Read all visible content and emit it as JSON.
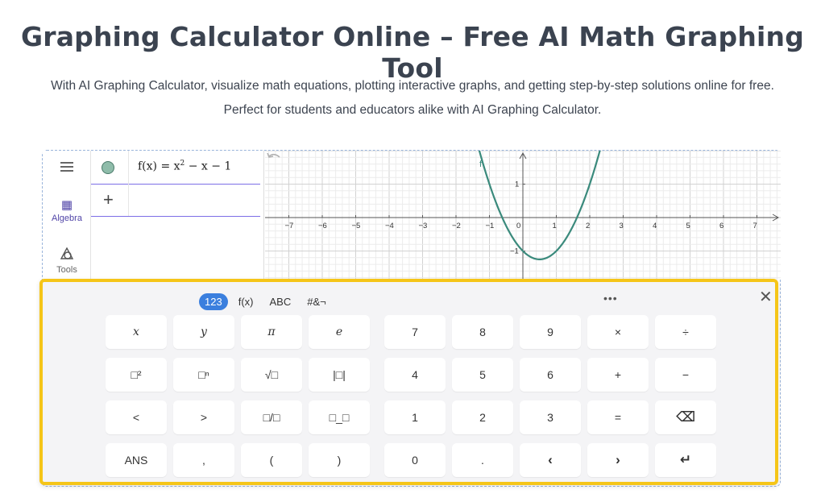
{
  "header": {
    "title": "Graphing Calculator Online – Free AI Math Graphing Tool",
    "subtitle": "With AI Graphing Calculator, visualize math equations, plotting interactive graphs, and getting step-by-step solutions online for free. Perfect for students and educators alike with AI Graphing Calculator."
  },
  "rail": {
    "menu_icon": "hamburger-icon",
    "algebra_label": "Algebra",
    "algebra_icon": "calculator-icon",
    "tools_label": "Tools",
    "tools_icon": "shapes-icon"
  },
  "algebra_view": {
    "expression_prefix": "f(x) = x",
    "expression_exp": "2",
    "expression_suffix": " − x − 1",
    "add_label": "+",
    "color": "#8fbcaa"
  },
  "graph": {
    "curve_label": "f",
    "curve_color": "#3a8a7c",
    "x_ticks": [
      "−7",
      "−6",
      "−5",
      "−4",
      "−3",
      "−2",
      "−1",
      "0",
      "1",
      "2",
      "3",
      "4",
      "5",
      "6",
      "7"
    ],
    "y_ticks": [
      "1",
      "−1"
    ]
  },
  "keyboard": {
    "tabs": [
      "123",
      "f(x)",
      "ABC",
      "#&¬"
    ],
    "active_tab": "123",
    "more_label": "•••",
    "close_label": "✕",
    "rows": [
      [
        "x",
        "y",
        "π",
        "e",
        "7",
        "8",
        "9",
        "×",
        "÷"
      ],
      [
        "□²",
        "□ⁿ",
        "√□",
        "|□|",
        "4",
        "5",
        "6",
        "+",
        "−"
      ],
      [
        "<",
        ">",
        "□/□",
        "□_□",
        "1",
        "2",
        "3",
        "=",
        "⌫"
      ],
      [
        "ANS",
        ",",
        "(",
        ")",
        "0",
        ".",
        "‹",
        "›",
        "↵"
      ]
    ]
  },
  "colors": {
    "accent": "#3b7fde",
    "highlight_border": "#f5c518",
    "algebra_active": "#5145a8"
  }
}
